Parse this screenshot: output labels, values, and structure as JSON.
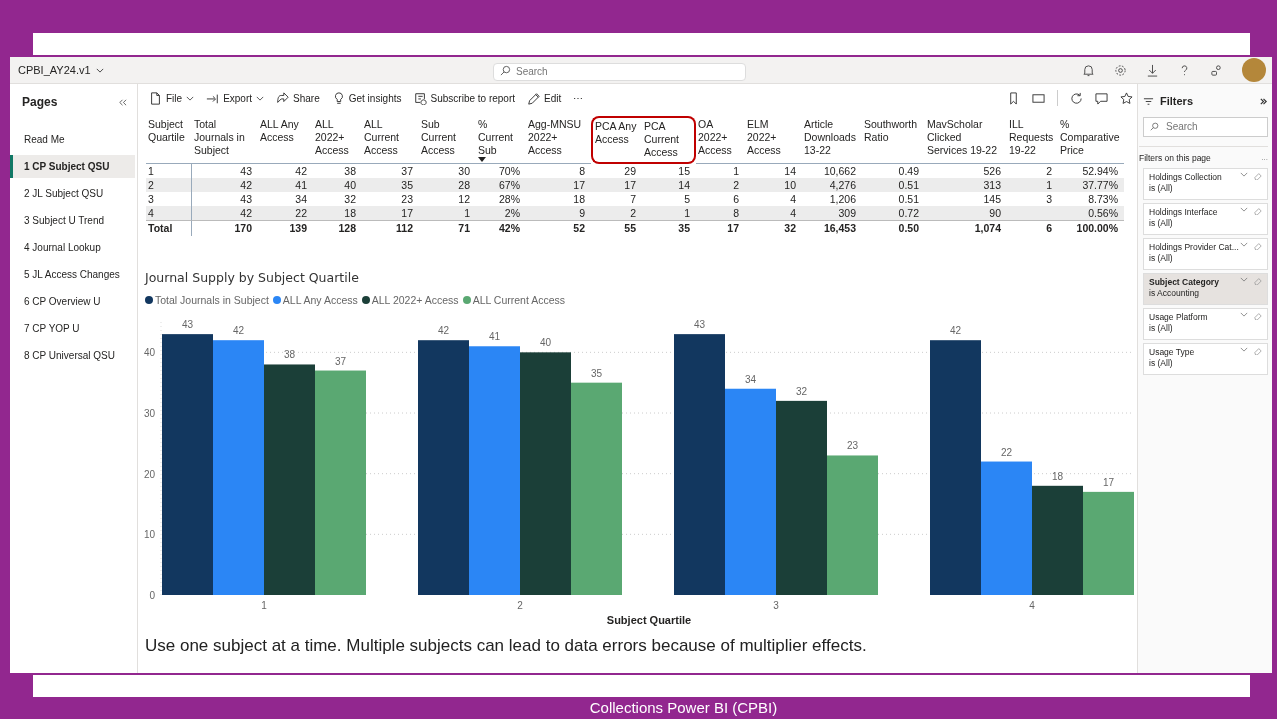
{
  "app": {
    "report_name": "CPBI_AY24.v1",
    "search_placeholder": "Search"
  },
  "pages_panel": {
    "title": "Pages",
    "items": [
      {
        "label": "Read Me",
        "selected": false
      },
      {
        "label": "1 CP Subject QSU",
        "selected": true
      },
      {
        "label": "2 JL Subject QSU",
        "selected": false
      },
      {
        "label": "3 Subject U Trend",
        "selected": false
      },
      {
        "label": "4 Journal Lookup",
        "selected": false
      },
      {
        "label": "5 JL Access Changes",
        "selected": false
      },
      {
        "label": "6 CP Overview U",
        "selected": false
      },
      {
        "label": "7 CP YOP U",
        "selected": false
      },
      {
        "label": "8 CP Universal QSU",
        "selected": false
      }
    ]
  },
  "toolbar": {
    "items": [
      {
        "label": "File",
        "kind": "menu"
      },
      {
        "label": "Export",
        "kind": "menu"
      },
      {
        "label": "Share",
        "kind": "action"
      },
      {
        "label": "Get insights",
        "kind": "action"
      },
      {
        "label": "Subscribe to report",
        "kind": "action"
      },
      {
        "label": "Edit",
        "kind": "action"
      }
    ],
    "more": "⋯"
  },
  "table": {
    "columns": [
      {
        "label": "Subject Quartile",
        "highlighted": false,
        "sorted": false
      },
      {
        "label": "Total Journals in Subject",
        "highlighted": false,
        "sorted": false
      },
      {
        "label": "ALL Any Access",
        "highlighted": false,
        "sorted": false
      },
      {
        "label": "ALL 2022+ Access",
        "highlighted": false,
        "sorted": false
      },
      {
        "label": "ALL Current Access",
        "highlighted": false,
        "sorted": false
      },
      {
        "label": "Sub Current Access",
        "highlighted": false,
        "sorted": false
      },
      {
        "label": "% Current Sub",
        "highlighted": false,
        "sorted": true
      },
      {
        "label": "Agg-MNSU 2022+ Access",
        "highlighted": false,
        "sorted": false
      },
      {
        "label": "PCA Any Access",
        "highlighted": true,
        "sorted": false
      },
      {
        "label": "PCA Current Access",
        "highlighted": true,
        "sorted": false
      },
      {
        "label": "OA 2022+ Access",
        "highlighted": false,
        "sorted": false
      },
      {
        "label": "ELM 2022+ Access",
        "highlighted": false,
        "sorted": false
      },
      {
        "label": "Article Downloads 13-22",
        "highlighted": false,
        "sorted": false
      },
      {
        "label": "Southworth Ratio",
        "highlighted": false,
        "sorted": false
      },
      {
        "label": "MavScholar Clicked Services 19-22",
        "highlighted": false,
        "sorted": false
      },
      {
        "label": "ILL Requests 19-22",
        "highlighted": false,
        "sorted": false
      },
      {
        "label": "% Comparative Price",
        "highlighted": false,
        "sorted": false
      }
    ],
    "rows": [
      {
        "kind": "data",
        "cells": [
          "1",
          "43",
          "42",
          "38",
          "37",
          "30",
          "70%",
          "8",
          "29",
          "15",
          "1",
          "14",
          "10,662",
          "0.49",
          "526",
          "2",
          "52.94%"
        ]
      },
      {
        "kind": "data",
        "cells": [
          "2",
          "42",
          "41",
          "40",
          "35",
          "28",
          "67%",
          "17",
          "17",
          "14",
          "2",
          "10",
          "4,276",
          "0.51",
          "313",
          "1",
          "37.77%"
        ]
      },
      {
        "kind": "data",
        "cells": [
          "3",
          "43",
          "34",
          "32",
          "23",
          "12",
          "28%",
          "18",
          "7",
          "5",
          "6",
          "4",
          "1,206",
          "0.51",
          "145",
          "3",
          "8.73%"
        ]
      },
      {
        "kind": "data",
        "cells": [
          "4",
          "42",
          "22",
          "18",
          "17",
          "1",
          "2%",
          "9",
          "2",
          "1",
          "8",
          "4",
          "309",
          "0.72",
          "90",
          null,
          "0.56%"
        ]
      },
      {
        "kind": "total",
        "cells": [
          "Total",
          "170",
          "139",
          "128",
          "112",
          "71",
          "42%",
          "52",
          "55",
          "35",
          "17",
          "32",
          "16,453",
          "0.50",
          "1,074",
          "6",
          "100.00%"
        ]
      }
    ]
  },
  "chart": {
    "chart_data": {
      "type": "bar",
      "title": "Journal Supply by Subject Quartile",
      "xlabel": "Subject Quartile",
      "categories": [
        "1",
        "2",
        "3",
        "4"
      ],
      "series": [
        {
          "name": "Total Journals in Subject",
          "color": "#12375f",
          "values": [
            43,
            42,
            43,
            42
          ]
        },
        {
          "name": "ALL Any Access",
          "color": "#2b86f5",
          "values": [
            42,
            41,
            34,
            22
          ]
        },
        {
          "name": "ALL 2022+ Access",
          "color": "#1b3f38",
          "values": [
            38,
            40,
            32,
            18
          ]
        },
        {
          "name": "ALL Current Access",
          "color": "#5aa872",
          "values": [
            37,
            35,
            23,
            17
          ]
        }
      ],
      "ylim": [
        0,
        45
      ],
      "yticks": [
        0,
        10,
        20,
        30,
        40
      ],
      "grid": true,
      "data_labels": true
    }
  },
  "note": "Use one subject at a time. Multiple subjects can lead to data errors because of multiplier effects.",
  "filters_panel": {
    "title": "Filters",
    "search_placeholder": "Search",
    "section": "Filters on this page",
    "more": "...",
    "filters": [
      {
        "name": "Holdings Collection",
        "value": "is (All)",
        "selected": false
      },
      {
        "name": "Holdings Interface",
        "value": "is (All)",
        "selected": false
      },
      {
        "name": "Holdings Provider Cat...",
        "value": "is (All)",
        "selected": false
      },
      {
        "name": "Subject Category",
        "value": "is Accounting",
        "selected": true
      },
      {
        "name": "Usage Platform",
        "value": "is (All)",
        "selected": false
      },
      {
        "name": "Usage Type",
        "value": "is (All)",
        "selected": false
      }
    ]
  },
  "slide_footer": "Collections Power BI (CPBI)"
}
